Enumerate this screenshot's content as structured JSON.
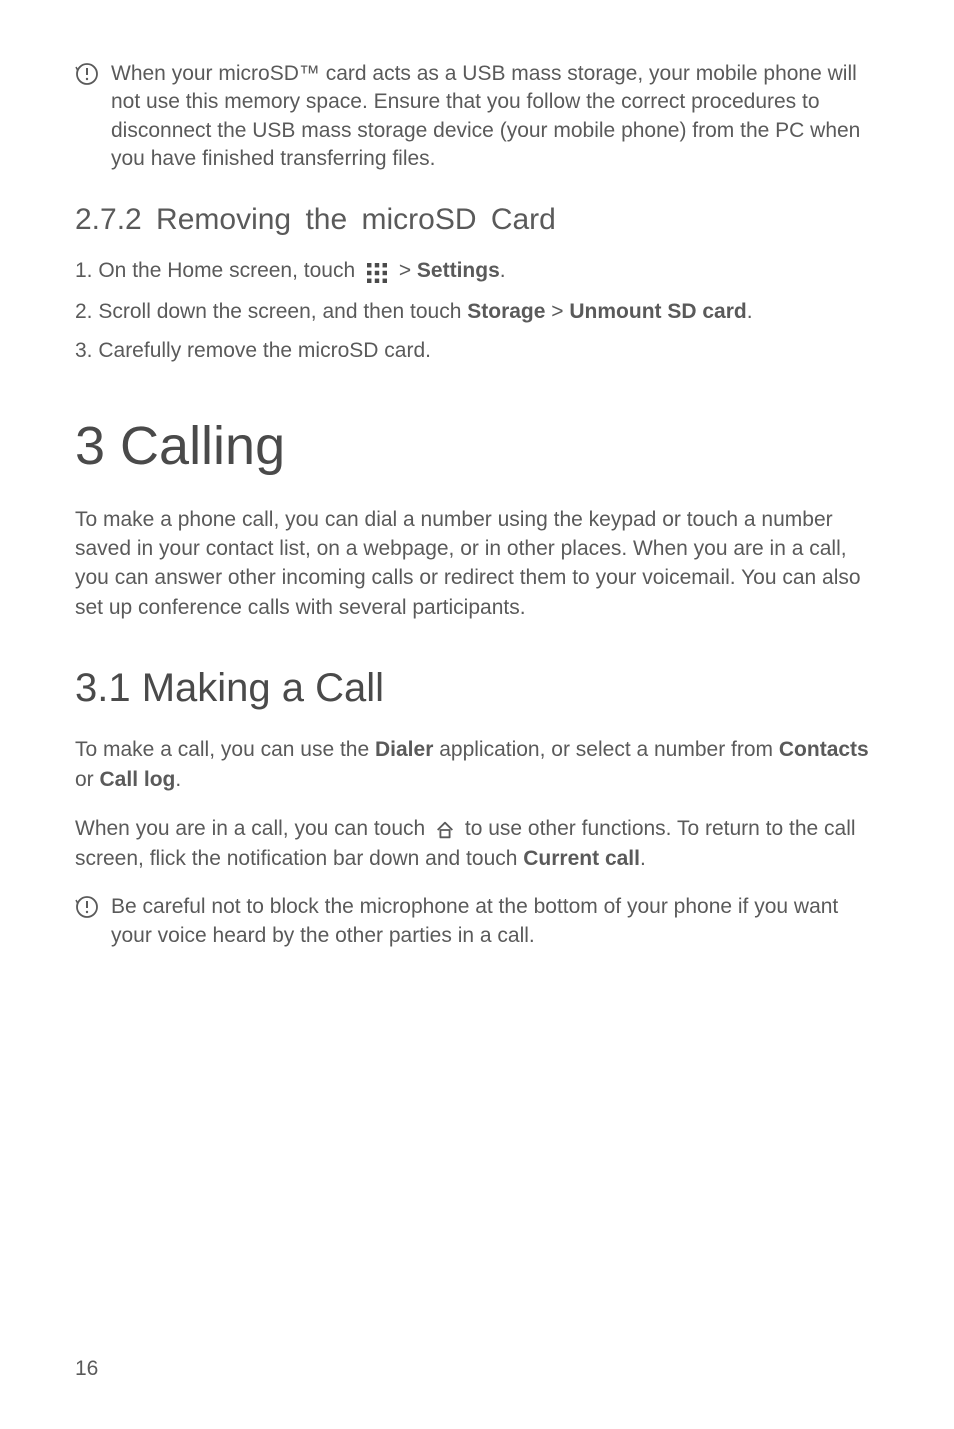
{
  "note1": {
    "text": "When your microSD™ card acts as a USB mass storage, your mobile phone will not use this memory space. Ensure that you follow the correct procedures to disconnect the USB mass storage device (your mobile phone) from the PC when you have finished transferring files."
  },
  "section_272": {
    "heading": "2.7.2  Removing the microSD Card",
    "step1_before": "1. On the Home screen, touch ",
    "step1_after_icon": " > ",
    "step1_bold": "Settings",
    "step1_end": ".",
    "step2_before": "2. Scroll down the screen, and then touch ",
    "step2_bold1": "Storage",
    "step2_mid": " > ",
    "step2_bold2": "Unmount SD card",
    "step2_end": ".",
    "step3": "3. Carefully remove the microSD card."
  },
  "section_3": {
    "heading": "3  Calling",
    "intro": "To make a phone call, you can dial a number using the keypad or touch a number saved in your contact list, on a webpage, or in other places. When you are in a call, you can answer other incoming calls or redirect them to your voicemail. You can also set up conference calls with several participants."
  },
  "section_31": {
    "heading": "3.1  Making a Call",
    "p1_before": "To make a call, you can use the ",
    "p1_bold1": "Dialer",
    "p1_mid": " application, or select a number from ",
    "p1_bold2": "Contacts",
    "p1_mid2": " or ",
    "p1_bold3": "Call log",
    "p1_end": ".",
    "p2_before": "When you are in a call, you can touch ",
    "p2_after_icon": " to use other functions. To return to the call screen, flick the notification bar down and touch ",
    "p2_bold": "Current call",
    "p2_end": "."
  },
  "note2": {
    "text": "Be careful not to block the microphone at the bottom of your phone if you want your voice heard by the other parties in a call."
  },
  "page_number": "16"
}
